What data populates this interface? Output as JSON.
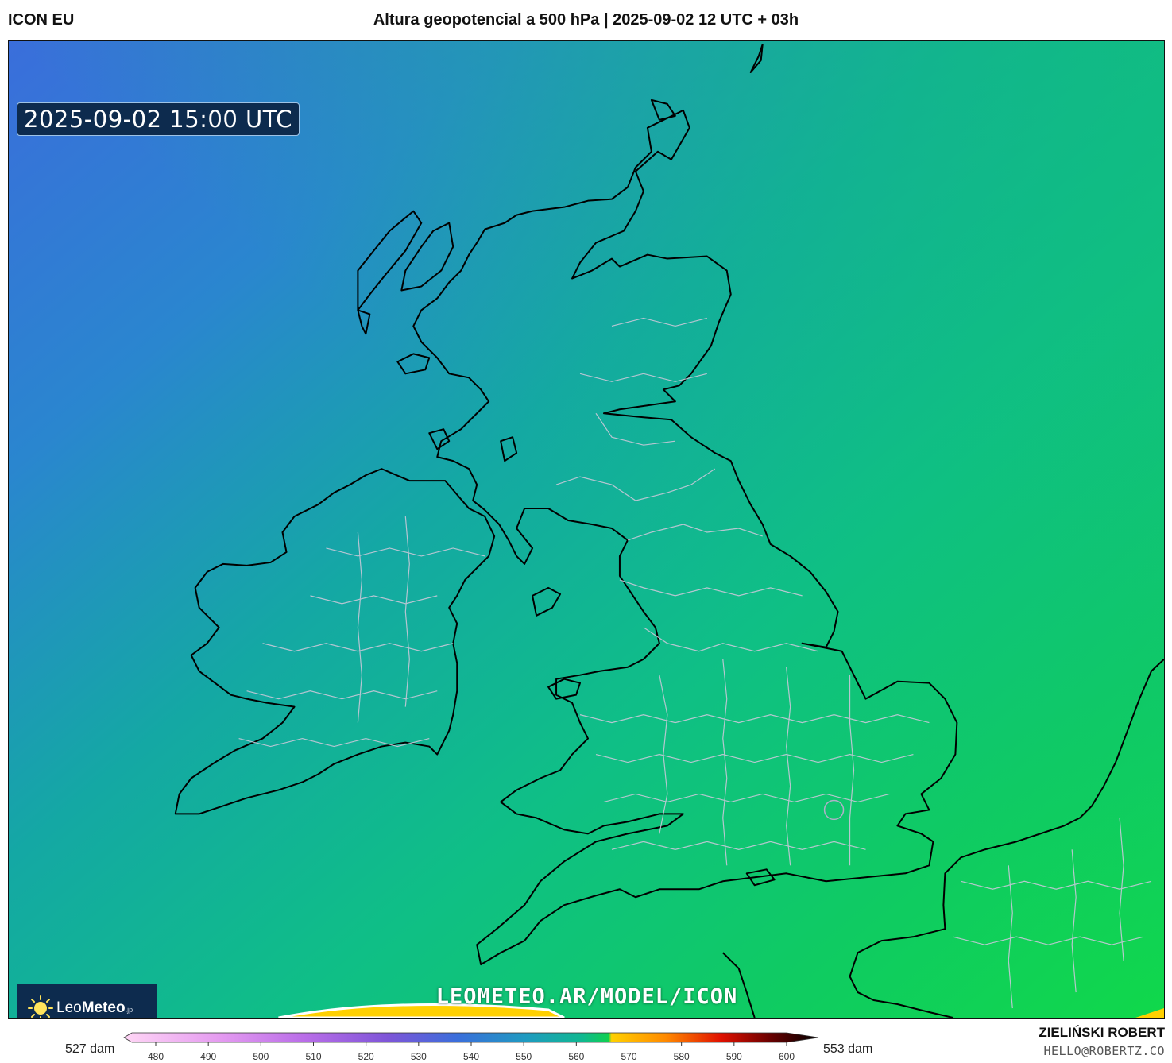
{
  "header": {
    "model": "ICON EU",
    "title": "Altura geopotencial a 500 hPa | 2025-09-02 12 UTC + 03h"
  },
  "map": {
    "valid_time": "2025-09-02 15:00 UTC",
    "watermark": "LEOMETEO.AR/MODEL/ICON",
    "field": "500 hPa geopotential height",
    "region": "British Isles and North Sea",
    "logo": {
      "name": "LeoMeteo",
      "part1": "Leo",
      "part2": "Meteo",
      "suffix": ".jp"
    }
  },
  "colorbar": {
    "min_label": "527 dam",
    "max_label": "553 dam",
    "ticks": [
      "480",
      "490",
      "500",
      "510",
      "520",
      "530",
      "540",
      "550",
      "560",
      "570",
      "580",
      "590",
      "600"
    ],
    "range": [
      480,
      600
    ],
    "colors": {
      "low": "#ffd6f5",
      "purple": "#8e58e0",
      "blue": "#3a6edb",
      "teal": "#14a8a4",
      "green": "#10d050",
      "yellow": "#ffd000",
      "orange": "#ff7a00",
      "red": "#d00000",
      "darkred": "#5a0000",
      "black": "#000000"
    }
  },
  "credits": {
    "author": "ZIELIŃSKI ROBERT",
    "email": "HELLO@ROBERTZ.CO"
  }
}
